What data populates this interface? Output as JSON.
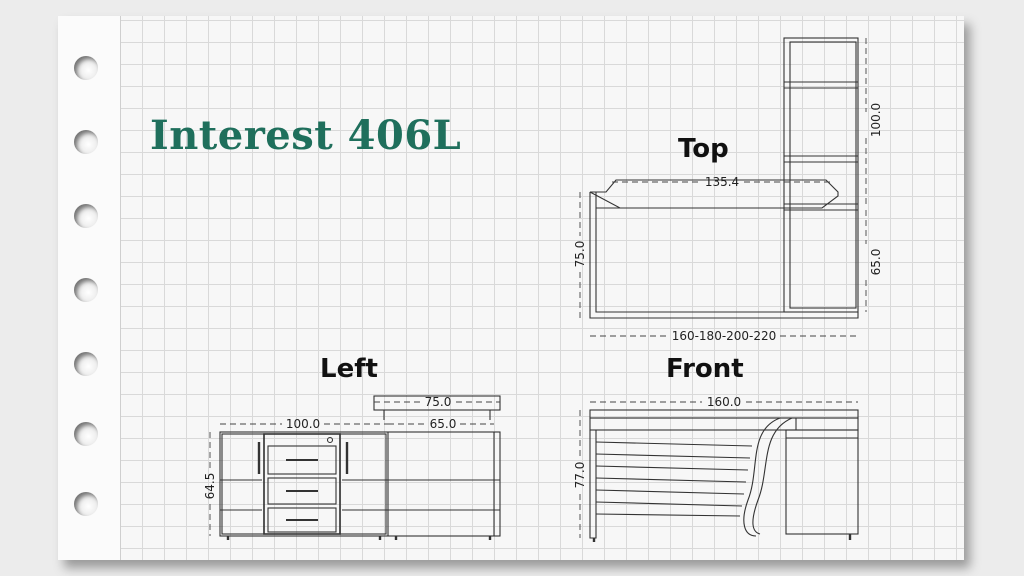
{
  "title": "Interest 406L",
  "views": {
    "top": {
      "label": "Top",
      "dim_desk_width": "135.4",
      "dim_return_length": "100.0",
      "dim_depth": "75.0",
      "dim_return_depth": "65.0",
      "dim_lengths": "160-180-200-220"
    },
    "left": {
      "label": "Left",
      "dim_cabinet_width": "100.0",
      "dim_top_width": "75.0",
      "dim_inner_width": "65.0",
      "dim_height": "64.5"
    },
    "front": {
      "label": "Front",
      "dim_width": "160.0",
      "dim_height": "77.0"
    }
  }
}
